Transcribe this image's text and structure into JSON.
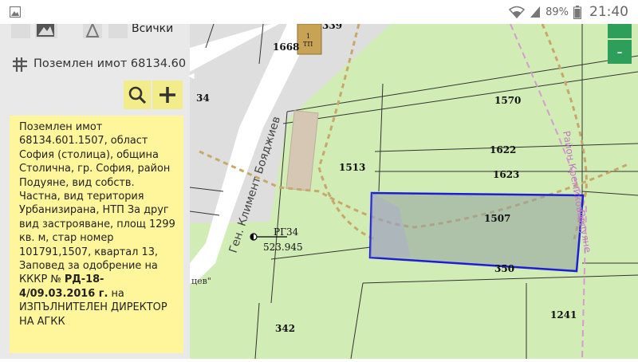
{
  "status_bar": {
    "battery": "89%",
    "time": "21:40"
  },
  "sidebar": {
    "layer_all_label": "Всички",
    "parcel_header": "Поземлен имот 68134.60",
    "info": {
      "text_main": "Поземлен имот 68134.601.1507, област София (столица), община Столична, гр. София, район Подуяне, вид собств. Частна, вид територия Урбанизирана, НТП За друг вид застрояване, площ 1299 кв. м, стар номер 101791,1507, квартал 13, Заповед за одобрение на КККР №",
      "order_number": "РД-18-4/09.03.2016 г.",
      "text_tail": "на ИЗПЪЛНИТЕЛЕН ДИРЕКТОР НА АГКК"
    }
  },
  "map": {
    "zoom_out_label": "-",
    "parcels": {
      "p1668": "1668",
      "p339": "339",
      "tp_top": "1",
      "tp_bottom": "ТП",
      "p34": "34",
      "p1570": "1570",
      "p1622": "1622",
      "p1623": "1623",
      "p1513": "1513",
      "p1507": "1507",
      "p350": "350",
      "p1241": "1241",
      "p342": "342"
    },
    "street_main": "Ген. Климент Бояджиев",
    "street_fragment": "цев\"",
    "street_right_1": "Район Кремиковци",
    "street_right_2": "Подуяне",
    "survey_point_label": "РГ34",
    "survey_point_value": "523.945",
    "colors": {
      "green": "#d2ecb6",
      "gray": "#dedede",
      "selection": "#1d1dd6",
      "path": "#c8a86a"
    }
  }
}
